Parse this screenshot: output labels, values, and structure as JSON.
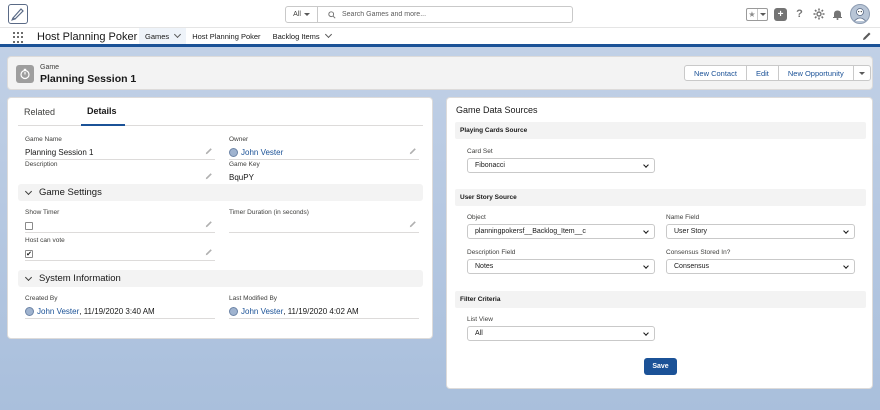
{
  "global_header": {
    "search_scope": "All",
    "search_placeholder": "Search Games and more...",
    "favorite_star": "★"
  },
  "nav": {
    "app_name": "Host Planning Poker",
    "tabs": [
      {
        "label": "Games",
        "active": true,
        "has_dropdown": true
      },
      {
        "label": "Host Planning Poker",
        "active": false,
        "has_dropdown": false
      },
      {
        "label": "Backlog Items",
        "active": false,
        "has_dropdown": true
      }
    ]
  },
  "record": {
    "object_type": "Game",
    "title": "Planning Session 1",
    "actions": [
      "New Contact",
      "Edit",
      "New Opportunity"
    ]
  },
  "details_card": {
    "tabs": [
      {
        "label": "Related",
        "active": false
      },
      {
        "label": "Details",
        "active": true
      }
    ],
    "fields": {
      "game_name": {
        "label": "Game Name",
        "value": "Planning Session 1"
      },
      "owner": {
        "label": "Owner",
        "value": "John Vester"
      },
      "description": {
        "label": "Description",
        "value": ""
      },
      "game_key": {
        "label": "Game Key",
        "value": "BquPY"
      }
    },
    "game_settings": {
      "header": "Game Settings",
      "show_timer": {
        "label": "Show Timer",
        "checked": false
      },
      "timer_duration": {
        "label": "Timer Duration (in seconds)",
        "value": ""
      },
      "host_can_vote": {
        "label": "Host can vote",
        "checked": true,
        "check_glyph": "✔"
      }
    },
    "system_information": {
      "header": "System Information",
      "created_by": {
        "label": "Created By",
        "user": "John Vester",
        "timestamp": ", 11/19/2020 3:40 AM"
      },
      "last_modified_by": {
        "label": "Last Modified By",
        "user": "John Vester",
        "timestamp": ", 11/19/2020 4:02 AM"
      }
    }
  },
  "data_sources_card": {
    "title": "Game Data Sources",
    "playing_cards": {
      "header": "Playing Cards Source",
      "card_set": {
        "label": "Card Set",
        "value": "Fibonacci"
      }
    },
    "user_story": {
      "header": "User Story Source",
      "object": {
        "label": "Object",
        "value": "planningpokersf__Backlog_Item__c"
      },
      "name_field": {
        "label": "Name Field",
        "value": "User Story"
      },
      "description_field": {
        "label": "Description Field",
        "value": "Notes"
      },
      "consensus_stored_in": {
        "label": "Consensus Stored In?",
        "value": "Consensus"
      }
    },
    "filter_criteria": {
      "header": "Filter Criteria",
      "list_view": {
        "label": "List View",
        "value": "All"
      }
    },
    "save_label": "Save"
  },
  "colors": {
    "brand": "#1b5297",
    "page_background": "#b0c4df",
    "section_header": "#f3f3f3"
  }
}
